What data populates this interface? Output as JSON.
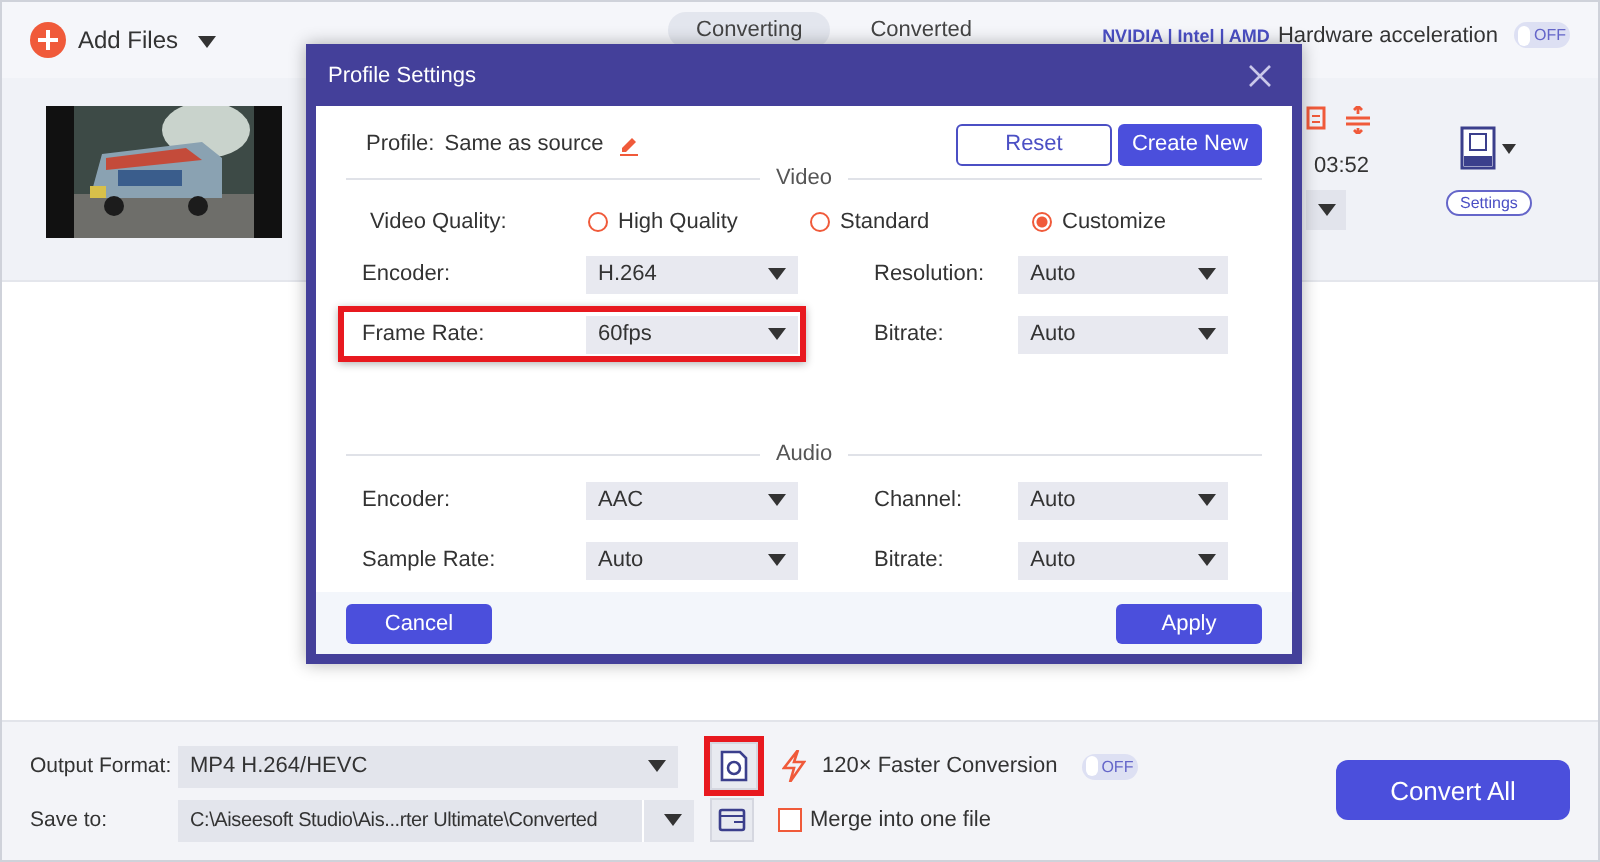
{
  "toolbar": {
    "add_files": "Add Files",
    "tabs": [
      {
        "label": "Converting",
        "selected": true
      },
      {
        "label": "Converted",
        "selected": false
      }
    ],
    "gpu_brands": "NVIDIA | Intel | AMD",
    "hardware_acceleration": {
      "label": "Hardware acceleration",
      "toggle": "OFF",
      "on": false
    }
  },
  "file_item": {
    "duration": "03:52",
    "format_settings": "Settings"
  },
  "dialog": {
    "title": "Profile Settings",
    "profile_label": "Profile:",
    "profile_value": "Same as source",
    "buttons": [
      "Reset",
      "Create New"
    ],
    "video": {
      "title": "Video",
      "quality_label": "Video Quality:",
      "quality_options": [
        {
          "label": "High Quality",
          "selected": false
        },
        {
          "label": "Standard",
          "selected": false
        },
        {
          "label": "Customize",
          "selected": true
        }
      ],
      "fields": [
        {
          "label": "Encoder:",
          "value": "H.264",
          "highlighted": false
        },
        {
          "label": "Resolution:",
          "value": "Auto",
          "highlighted": false
        },
        {
          "label": "Frame Rate:",
          "value": "60fps",
          "highlighted": true
        },
        {
          "label": "Bitrate:",
          "value": "Auto",
          "highlighted": false
        }
      ]
    },
    "audio": {
      "title": "Audio",
      "fields": [
        {
          "label": "Encoder:",
          "value": "AAC",
          "highlighted": false
        },
        {
          "label": "Channel:",
          "value": "Auto",
          "highlighted": false
        },
        {
          "label": "Sample Rate:",
          "value": "Auto",
          "highlighted": false
        },
        {
          "label": "Bitrate:",
          "value": "Auto",
          "highlighted": false
        }
      ]
    },
    "cancel": "Cancel",
    "apply": "Apply"
  },
  "bottom_bar": {
    "output_format": {
      "label": "Output Format:",
      "value": "MP4 H.264/HEVC"
    },
    "format_settings_button": {
      "highlighted": true
    },
    "faster_conversion": {
      "label": "120× Faster Conversion",
      "toggle": "OFF",
      "on": false
    },
    "save_to": {
      "label": "Save to:",
      "value": "C:\\Aiseesoft Studio\\Ais...rter Ultimate\\Converted"
    },
    "merge": {
      "label": "Merge into one file",
      "checked": false
    },
    "convert_all": "Convert All"
  }
}
